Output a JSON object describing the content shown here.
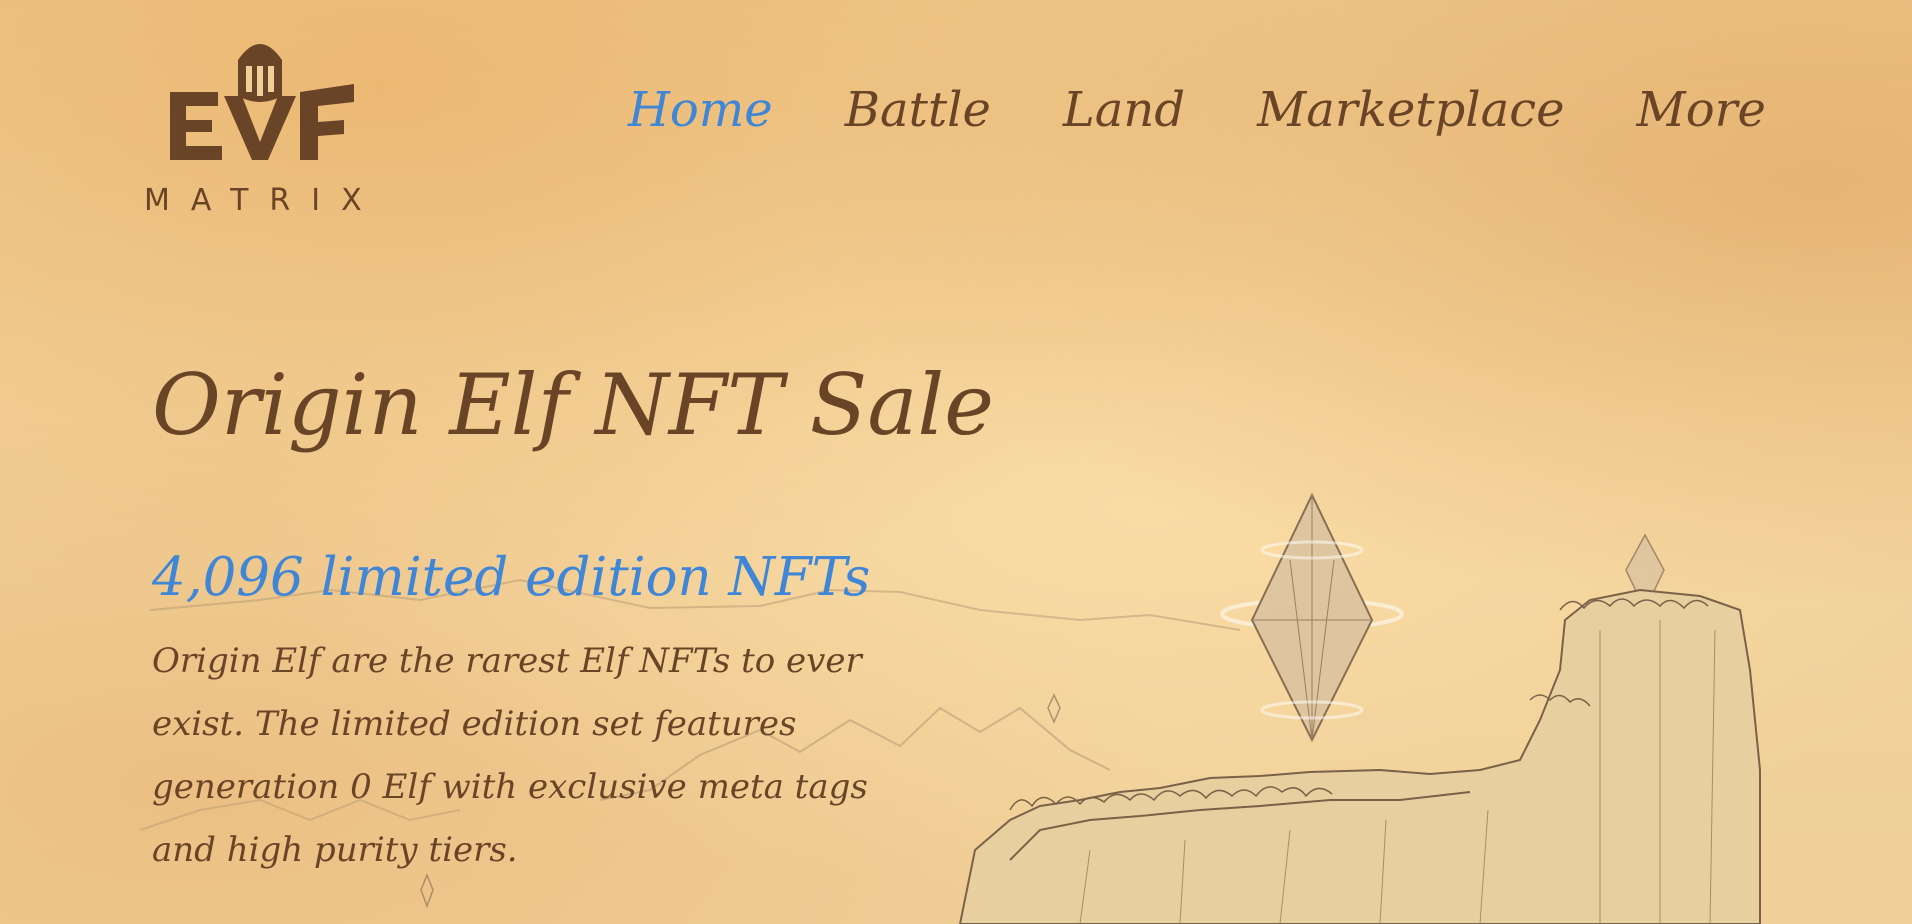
{
  "brand": {
    "logo_text": "EVF",
    "wordmark": "MATRIX",
    "primary_color": "#6a4426",
    "accent_color": "#3f86d6"
  },
  "nav": {
    "items": [
      {
        "label": "Home",
        "active": true
      },
      {
        "label": "Battle",
        "active": false
      },
      {
        "label": "Land",
        "active": false
      },
      {
        "label": "Marketplace",
        "active": false
      },
      {
        "label": "More",
        "active": false
      }
    ]
  },
  "hero": {
    "title": "Origin Elf NFT Sale",
    "subtitle": "4,096 limited edition NFTs",
    "description": "Origin Elf are the rarest Elf NFTs to ever exist. The limited edition set features generation 0 Elf with exclusive meta tags and high purity tiers."
  }
}
